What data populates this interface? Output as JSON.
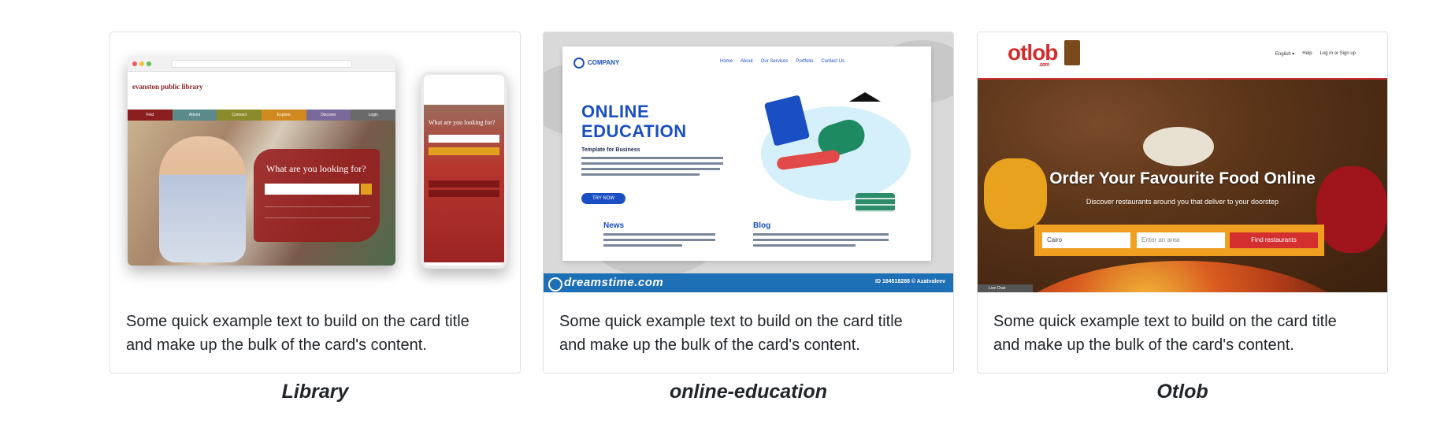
{
  "cards": [
    {
      "id": "library",
      "caption": "Library",
      "text": "Some quick example text to build on the card title and make up the bulk of the card's content.",
      "preview": {
        "logo": "evanston public library",
        "nav": [
          "Find",
          "Attend",
          "Connect",
          "Explore",
          "Discover",
          "Login"
        ],
        "nav_colors": [
          "#8b1e1e",
          "#5b8a8b",
          "#8a8b2a",
          "#d18a1f",
          "#7a6a9b",
          "#6a6a6a"
        ],
        "prompt": "What are you looking for?",
        "mobile_prompt": "What are you looking for?"
      }
    },
    {
      "id": "online-education",
      "caption": "online-education",
      "text": "Some quick example text to build on the card title and make up the bulk of the card's content.",
      "preview": {
        "company": "COMPANY",
        "menu": [
          "Home",
          "About",
          "Our Services",
          "Portfolio",
          "Contact Us"
        ],
        "title_line1": "ONLINE",
        "title_line2": "EDUCATION",
        "subtitle": "Template for Business",
        "button": "TRY NOW",
        "col1_title": "News",
        "col2_title": "Blog",
        "watermark": "dreamstime.com",
        "image_id": "ID 184518288 © Azatvaleev"
      }
    },
    {
      "id": "otlob",
      "caption": "Otlob",
      "text": "Some quick example text to build on the card title and make up the bulk of the card's content.",
      "preview": {
        "logo": "otlob",
        "logo_suffix": ".com",
        "menu": [
          "English ▾",
          "Help",
          "Log in or Sign up"
        ],
        "headline": "Order Your Favourite Food Online",
        "subheadline": "Discover restaurants around you that deliver to your doorstep",
        "city_value": "Cairo",
        "area_placeholder": "Enter an area",
        "search_button": "Find restaurants",
        "chat": "Live Chat"
      }
    }
  ]
}
